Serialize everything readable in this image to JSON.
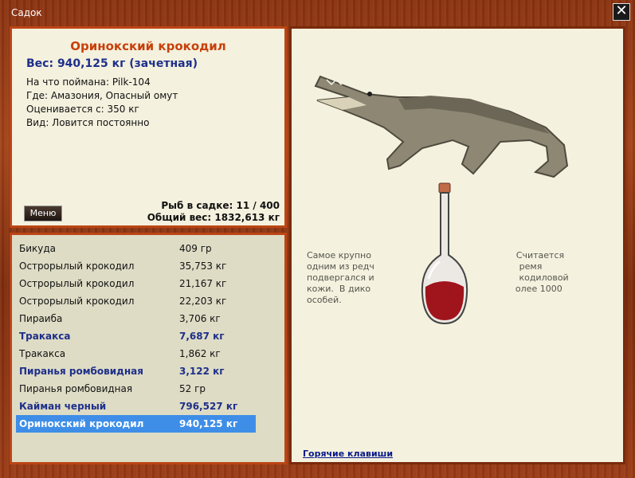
{
  "window": {
    "title": "Садок",
    "close_symbol": "✕"
  },
  "fish": {
    "name": "Оринокский крокодил",
    "weight": "Вес: 940,125 кг (зачетная)",
    "details": [
      "На что поймана: Pilk-104",
      "Где: Амазония, Опасный омут",
      "Оценивается с: 350 кг",
      "Вид: Ловится постоянно"
    ],
    "image_icon": "crocodile-image"
  },
  "menu_label": "Меню",
  "stats": {
    "count": "Рыб в садке: 11 / 400",
    "total": "Общий вес: 1832,613 кг"
  },
  "catch_list": [
    {
      "name": "Бикуда",
      "weight": "409 гр",
      "bold": false,
      "selected": false
    },
    {
      "name": "Острорылый крокодил",
      "weight": "35,753 кг",
      "bold": false,
      "selected": false
    },
    {
      "name": "Острорылый крокодил",
      "weight": "21,167 кг",
      "bold": false,
      "selected": false
    },
    {
      "name": "Острорылый крокодил",
      "weight": "22,203 кг",
      "bold": false,
      "selected": false
    },
    {
      "name": "Пираиба",
      "weight": "3,706 кг",
      "bold": false,
      "selected": false
    },
    {
      "name": "Тракакса",
      "weight": "7,687 кг",
      "bold": true,
      "selected": false
    },
    {
      "name": "Тракакса",
      "weight": "1,862 кг",
      "bold": false,
      "selected": false
    },
    {
      "name": "Пиранья ромбовидная",
      "weight": "3,122 кг",
      "bold": true,
      "selected": false
    },
    {
      "name": "Пиранья ромбовидная",
      "weight": "52 гр",
      "bold": false,
      "selected": false
    },
    {
      "name": "Кайман черный",
      "weight": "796,527 кг",
      "bold": true,
      "selected": false
    },
    {
      "name": "Оринокский крокодил",
      "weight": "940,125 кг",
      "bold": true,
      "selected": true
    }
  ],
  "description": [
    "Самое крупно                                                    Считается",
    "одним из редч                                                    ремя",
    "подвергался и                                                    кодиловой",
    "кожи.  В дико                                                    олее 1000",
    "особей."
  ],
  "hotkeys_label": "Горячие клавиши",
  "trophy_icon": "potion-flask-icon"
}
